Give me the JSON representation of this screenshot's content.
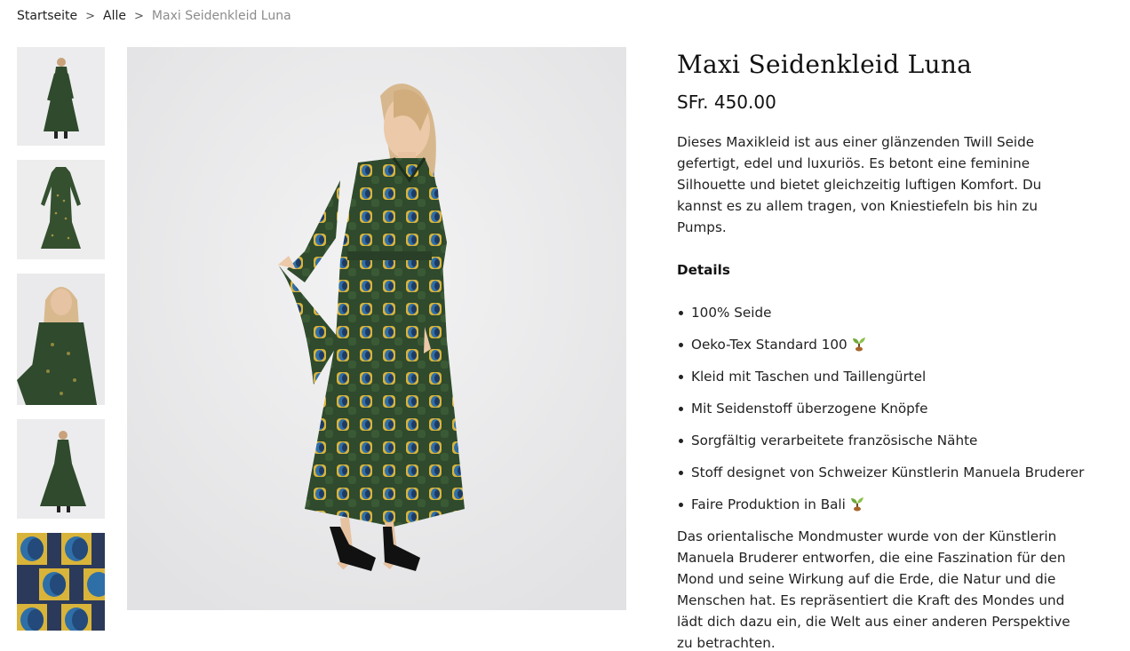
{
  "breadcrumb": {
    "home": "Startseite",
    "all": "Alle",
    "current": "Maxi Seidenkleid Luna",
    "separator": ">"
  },
  "thumbnails": [
    {
      "icon": "model-full-body-photo"
    },
    {
      "icon": "dress-flat-photo"
    },
    {
      "icon": "model-upper-body-photo"
    },
    {
      "icon": "model-full-body-photo"
    },
    {
      "icon": "fabric-pattern-closeup"
    }
  ],
  "main_image": {
    "icon": "model-wearing-dress-photo"
  },
  "product": {
    "title": "Maxi Seidenkleid Luna",
    "price": "SFr. 450.00",
    "description": "Dieses Maxikleid ist aus einer glänzenden Twill Seide gefertigt, edel und luxuriös. Es betont eine feminine Silhouette und bietet gleichzeitig luftigen Komfort. Du kannst es zu allem tragen, von Kniestiefeln bis hin zu Pumps.",
    "details_heading": "Details",
    "details": [
      {
        "text": "100% Seide",
        "sprout": false
      },
      {
        "text": "Oeko-Tex Standard 100",
        "sprout": true
      },
      {
        "text": "Kleid mit Taschen und Taillengürtel",
        "sprout": false
      },
      {
        "text": "Mit Seidenstoff überzogene Knöpfe",
        "sprout": false
      },
      {
        "text": "Sorgfältig verarbeitete französische Nähte",
        "sprout": false
      },
      {
        "text": "Stoff designet von Schweizer Künstlerin Manuela Bruderer",
        "sprout": false
      },
      {
        "text": "Faire Produktion in Bali",
        "sprout": true
      }
    ],
    "story": "Das orientalische Mondmuster wurde von der Künstlerin Manuela Bruderer entworfen, die eine Faszination für den Mond und seine Wirkung auf die Erde, die Natur und die Menschen hat. Es repräsentiert die Kraft des Mondes und lädt dich dazu ein, die Welt aus einer anderen Perspektive zu betrachten."
  },
  "colors": {
    "text": "#222222",
    "muted": "#8c8c8c",
    "dress_green": "#2f4a2c",
    "dress_blue": "#2f6fa8",
    "dress_yellow": "#d9b43a",
    "background_photo": "#ebebed"
  }
}
